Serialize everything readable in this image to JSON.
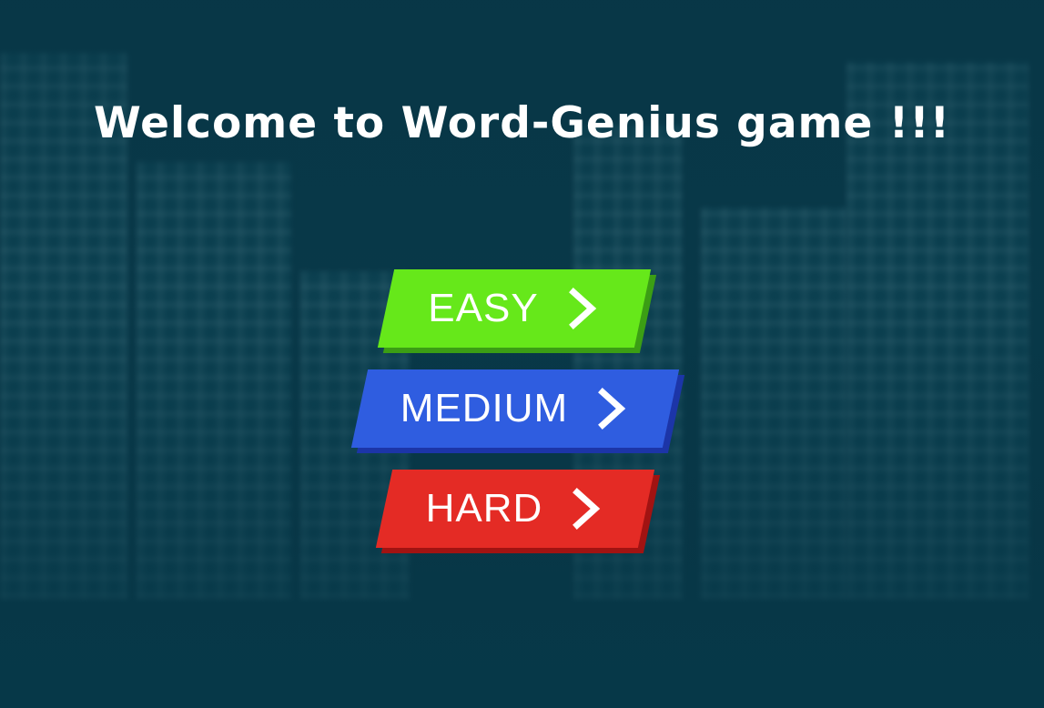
{
  "title": "Welcome to Word-Genius game !!!",
  "buttons": {
    "easy": {
      "label": "EASY",
      "icon": "chevron-right-icon",
      "color": "#66e81a"
    },
    "medium": {
      "label": "MEDIUM",
      "icon": "chevron-right-icon",
      "color": "#2f5de0"
    },
    "hard": {
      "label": "HARD",
      "icon": "chevron-right-icon",
      "color": "#e42b25"
    }
  },
  "colors": {
    "background": "#0a3a4a",
    "text": "#ffffff"
  }
}
